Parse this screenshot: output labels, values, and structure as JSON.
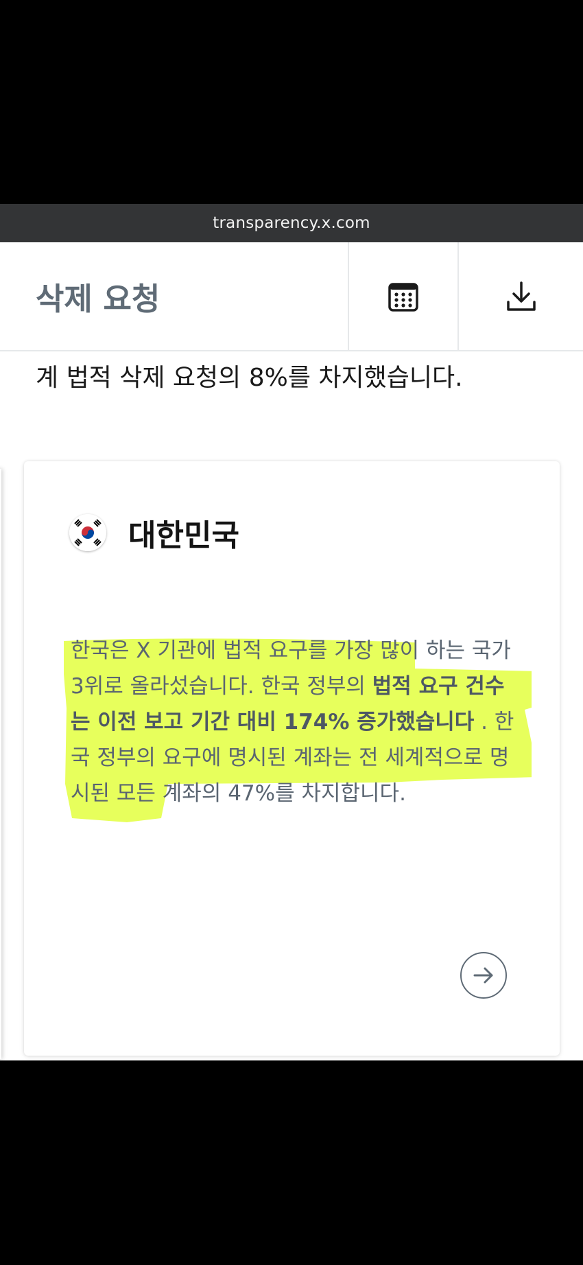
{
  "browser": {
    "url": "transparency.x.com"
  },
  "header": {
    "title": "삭제 요청",
    "calendar_icon": "calendar-icon",
    "download_icon": "download-icon"
  },
  "lead": {
    "text": "계 법적 삭제 요청의 8%를 차지했습니다."
  },
  "card": {
    "country": "대한민국",
    "flag_icon": "south-korea-flag-icon",
    "paragraph": {
      "part1": "한국은 X 기관에 법적 요구를 가장 많이 하는 국가 3위로 올라섰습니다. 한국 정부의 ",
      "bold": "법적 요구 건수는 이전 보고 기간 대비 174% 증가했습니다",
      "part2": " . 한국 정부의 요구에 명시된 계좌는 전 세계적으로 명시된 모든 계좌의 47%를 차지합니다."
    },
    "next_icon": "arrow-right-icon"
  },
  "colors": {
    "highlight": "#e4ff4a",
    "header_title": "#5f6b76",
    "url_bar": "#333436"
  }
}
